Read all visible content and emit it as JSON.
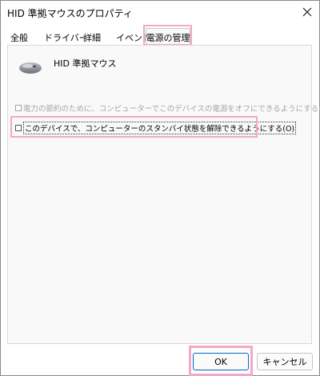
{
  "window": {
    "title": "HID 準拠マウスのプロパティ"
  },
  "tabs": [
    {
      "label": "全般"
    },
    {
      "label": "ドライバー"
    },
    {
      "label": "詳細"
    },
    {
      "label": "イベント"
    },
    {
      "label": "電源の管理",
      "selected": true
    }
  ],
  "device": {
    "name": "HID 準拠マウス",
    "icon": "mouse-icon"
  },
  "power": {
    "allow_off_label": "電力の節約のために、コンピューターでこのデバイスの電源をオフにできるようにする(A)",
    "allow_off_checked": false,
    "allow_off_enabled": false,
    "allow_wake_label": "このデバイスで、コンピューターのスタンバイ状態を解除できるようにする(O)",
    "allow_wake_checked": false,
    "allow_wake_enabled": true
  },
  "buttons": {
    "ok_label": "OK",
    "cancel_label": "キャンセル"
  },
  "colors": {
    "highlight": "#f2a8c8",
    "accent": "#0067c0"
  }
}
